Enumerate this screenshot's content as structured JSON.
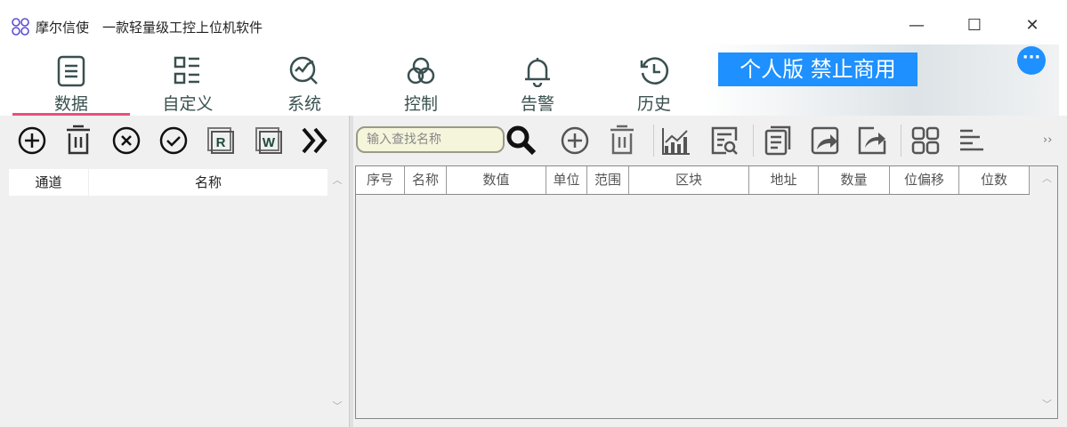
{
  "window": {
    "title": "摩尔信使　一款轻量级工控上位机软件",
    "minimize": "—",
    "maximize": "☐",
    "close": "✕"
  },
  "nav": {
    "items": [
      {
        "label": "数据"
      },
      {
        "label": "自定义"
      },
      {
        "label": "系统"
      },
      {
        "label": "控制"
      },
      {
        "label": "告警"
      },
      {
        "label": "历史"
      }
    ],
    "badge": "个人版  禁止商用",
    "more": "···"
  },
  "left": {
    "columns": [
      "通道",
      "名称"
    ]
  },
  "right": {
    "search_placeholder": "输入查找名称",
    "overflow": "››",
    "columns": [
      "序号",
      "名称",
      "数值",
      "单位",
      "范围",
      "区块",
      "地址",
      "数量",
      "位偏移",
      "位数"
    ]
  },
  "colors": {
    "accent": "#1e90ff",
    "underline": "#ec4f7f"
  }
}
